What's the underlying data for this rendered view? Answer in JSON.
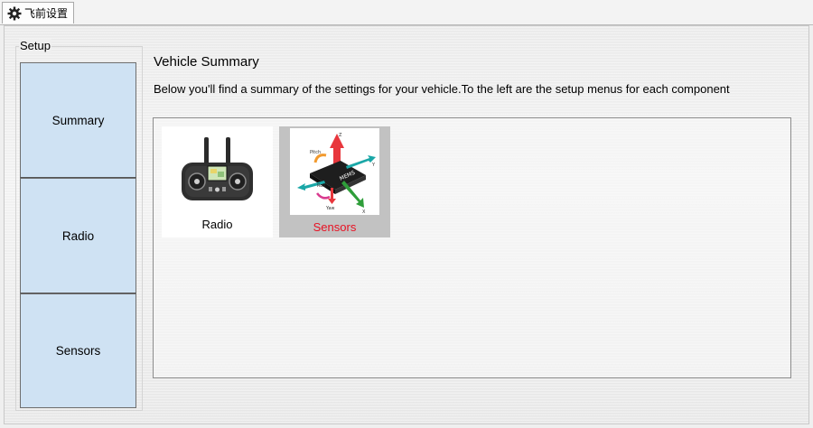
{
  "tab": {
    "label": "飞前设置",
    "icon": "gear-icon"
  },
  "setup": {
    "title": "Setup",
    "items": [
      {
        "label": "Summary"
      },
      {
        "label": "Radio"
      },
      {
        "label": "Sensors"
      }
    ]
  },
  "content": {
    "title": "Vehicle Summary",
    "description": "Below you'll find a summary of the settings for your vehicle.To the left are the setup menus for each component"
  },
  "cards": [
    {
      "label": "Radio",
      "icon": "radio-transmitter-icon",
      "label_color": "#000000"
    },
    {
      "label": "Sensors",
      "icon": "mems-sensor-icon",
      "label_color": "#e81123"
    }
  ],
  "sensor_diagram": {
    "chip_label": "MEMS",
    "axes": {
      "z": "Z",
      "y": "Y",
      "x": "X"
    },
    "rotations": {
      "pitch": "Pitch",
      "roll": "Roll",
      "yaw": "Yaw"
    }
  }
}
